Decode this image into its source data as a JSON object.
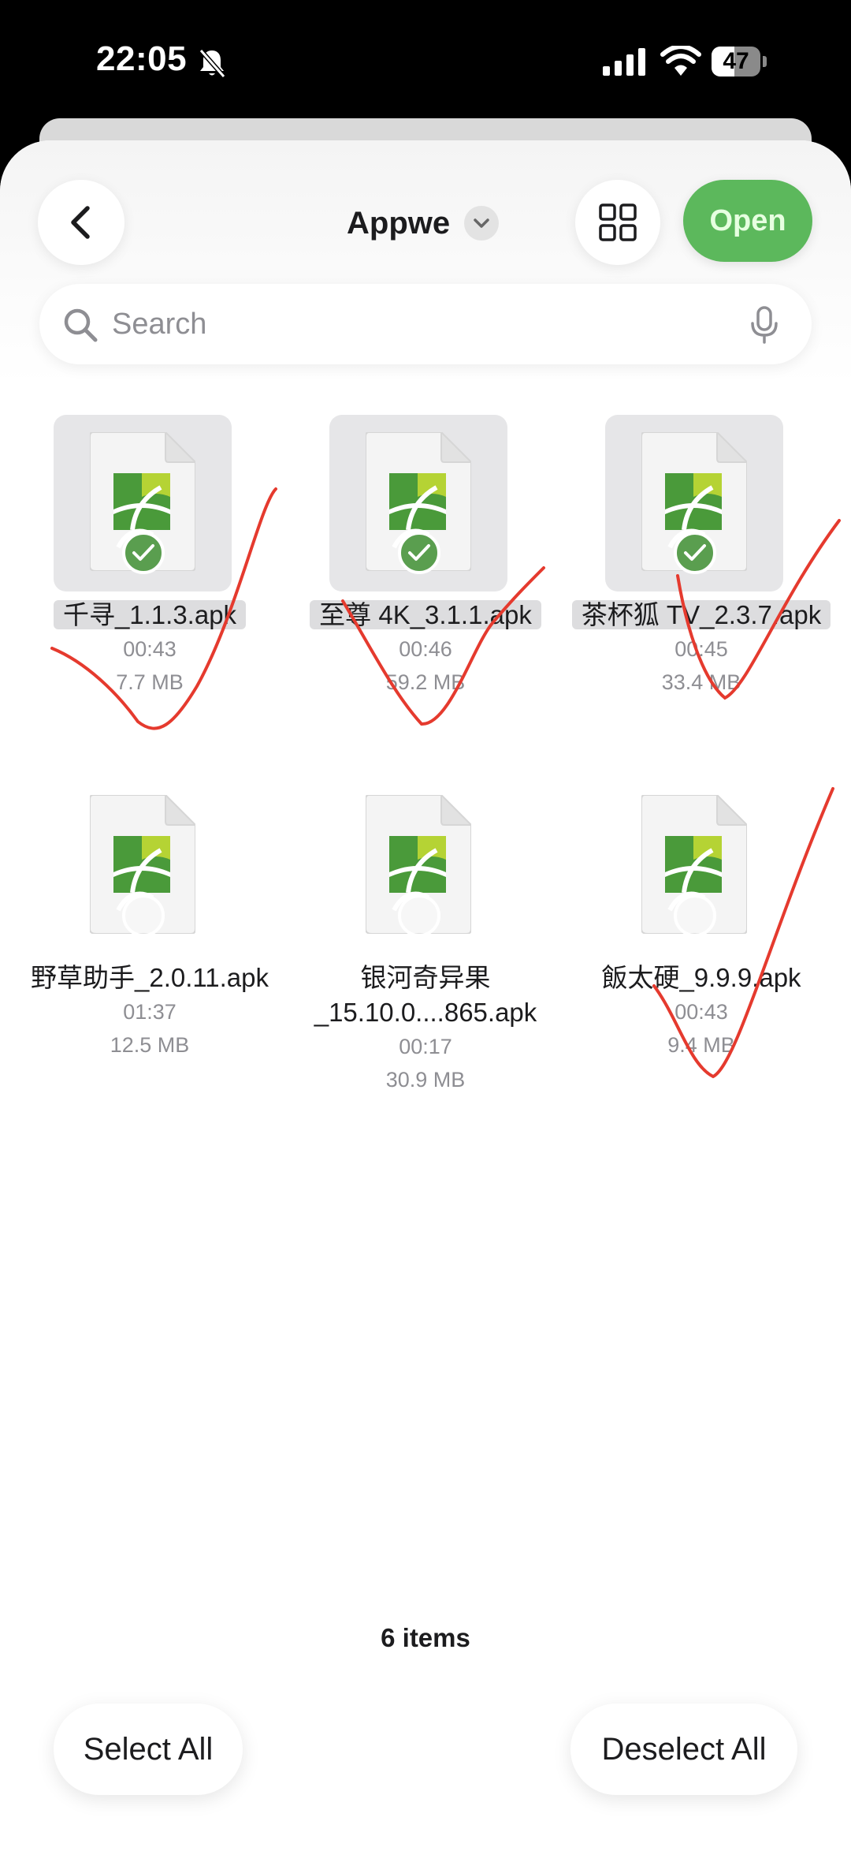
{
  "status_bar": {
    "time": "22:05",
    "battery_level": 47,
    "battery_text": "47",
    "icons": [
      "bell-muted-icon",
      "signal-icon",
      "wifi-icon",
      "battery-icon"
    ]
  },
  "header": {
    "folder_title": "Appwe",
    "open_label": "Open",
    "icons": [
      "back-chevron-icon",
      "chevron-down-icon",
      "grid-view-icon"
    ]
  },
  "search": {
    "placeholder": "Search",
    "icons": [
      "search-icon",
      "mic-icon"
    ]
  },
  "colors": {
    "accent": "#5cb85c",
    "check": "#5a9e4f",
    "annotation": "#e53a2e"
  },
  "files": [
    {
      "name": "千寻_1.1.3.apk",
      "time": "00:43",
      "size": "7.7 MB",
      "selected": true
    },
    {
      "name": "至尊 4K_3.1.1.apk",
      "time": "00:46",
      "size": "59.2 MB",
      "selected": true
    },
    {
      "name": "茶杯狐 TV_2.3.7.apk",
      "time": "00:45",
      "size": "33.4 MB",
      "selected": true
    },
    {
      "name": "野草助手_2.0.11.apk",
      "time": "01:37",
      "size": "12.5 MB",
      "selected": false
    },
    {
      "name": "银河奇异果",
      "name_line2": "_15.10.0....865.apk",
      "time": "00:17",
      "size": "30.9 MB",
      "selected": false
    },
    {
      "name": "飯太硬_9.9.9.apk",
      "time": "00:43",
      "size": "9.4 MB",
      "selected": false
    }
  ],
  "footer": {
    "item_count": "6 items",
    "select_all_label": "Select All",
    "deselect_all_label": "Deselect All"
  }
}
